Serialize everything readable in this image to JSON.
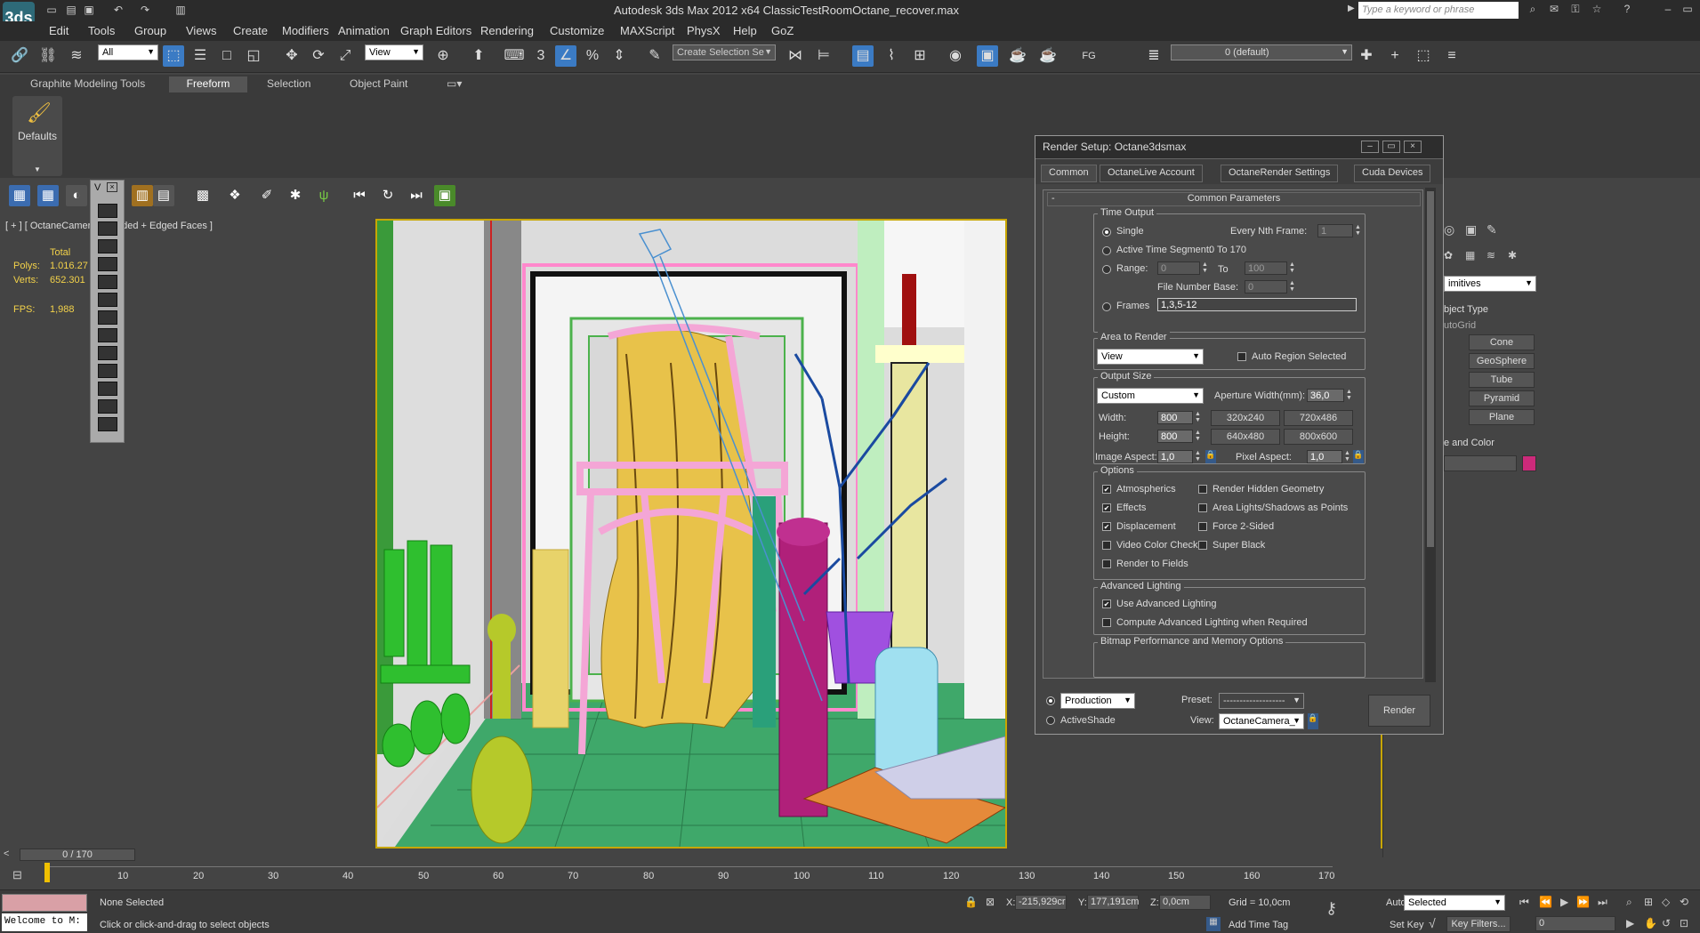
{
  "window": {
    "title": "Autodesk 3ds Max  2012 x64      ClassicTestRoomOctane_recover.max",
    "search_placeholder": "Type a keyword or phrase",
    "logo": "3ds"
  },
  "menu": [
    "Edit",
    "Tools",
    "Group",
    "Views",
    "Create",
    "Modifiers",
    "Animation",
    "Graph Editors",
    "Rendering",
    "Customize",
    "MAXScript",
    "PhysX",
    "Help",
    "GoZ"
  ],
  "toolbar": {
    "selection_filter": "All",
    "ref_coord": "View",
    "named_selection_placeholder": "Create Selection Se",
    "fg_label": "FG",
    "layer": "0 (default)"
  },
  "ribbon": {
    "tabs": [
      "Graphite Modeling Tools",
      "Freeform",
      "Selection",
      "Object Paint"
    ],
    "active_tab": "Freeform",
    "defaults_label": "Defaults"
  },
  "viewport": {
    "label": "[ + ] [ OctaneCamera [ Shaded + Edged Faces ]",
    "float_title": "V",
    "stats": {
      "total_label": "Total",
      "polys_label": "Polys:",
      "polys": "1.016.27",
      "verts_label": "Verts:",
      "verts": "652.301",
      "fps_label": "FPS:",
      "fps": "1,988"
    }
  },
  "command_panel": {
    "dropdown": "imitives",
    "object_type_header": "bject Type",
    "autogrid": "utoGrid",
    "buttons": [
      "Cone",
      "GeoSphere",
      "Tube",
      "Pyramid",
      "Plane"
    ],
    "name_color_header": "e and Color",
    "color_swatch": "#cc2a7a"
  },
  "render_setup": {
    "title": "Render Setup: Octane3dsmax",
    "tabs": [
      "Common",
      "OctaneLive Account",
      "OctaneRender Settings",
      "Cuda Devices"
    ],
    "active_tab": "Common",
    "rollout": "Common Parameters",
    "rollout_toggle": "-",
    "time_output": {
      "title": "Time Output",
      "single": "Single",
      "every_nth": "Every Nth Frame:",
      "every_nth_value": "1",
      "active_segment": "Active Time Segment:",
      "active_segment_value": "0 To 170",
      "range": "Range:",
      "range_from": "0",
      "range_to_label": "To",
      "range_to": "100",
      "file_number_base": "File Number Base:",
      "file_number_base_value": "0",
      "frames": "Frames",
      "frames_value": "1,3,5-12"
    },
    "area": {
      "title": "Area to Render",
      "value": "View",
      "auto_region": "Auto Region Selected"
    },
    "output_size": {
      "title": "Output Size",
      "preset": "Custom",
      "aperture_label": "Aperture Width(mm):",
      "aperture": "36,0",
      "width_label": "Width:",
      "width": "800",
      "height_label": "Height:",
      "height": "800",
      "presets": [
        "320x240",
        "720x486",
        "640x480",
        "800x600"
      ],
      "image_aspect_label": "Image Aspect:",
      "image_aspect": "1,0",
      "pixel_aspect_label": "Pixel Aspect:",
      "pixel_aspect": "1,0"
    },
    "options": {
      "title": "Options",
      "left": [
        {
          "label": "Atmospherics",
          "checked": true
        },
        {
          "label": "Effects",
          "checked": true
        },
        {
          "label": "Displacement",
          "checked": true
        },
        {
          "label": "Video Color Check",
          "checked": false
        },
        {
          "label": "Render to Fields",
          "checked": false
        }
      ],
      "right": [
        {
          "label": "Render Hidden Geometry",
          "checked": false
        },
        {
          "label": "Area Lights/Shadows as Points",
          "checked": false
        },
        {
          "label": "Force 2-Sided",
          "checked": false
        },
        {
          "label": "Super Black",
          "checked": false
        }
      ]
    },
    "advanced_lighting": {
      "title": "Advanced Lighting",
      "use": "Use Advanced Lighting",
      "compute": "Compute Advanced Lighting when Required"
    },
    "bitmap_title": "Bitmap Performance and Memory Options",
    "bottom": {
      "mode": "Production",
      "activeshade": "ActiveShade",
      "preset_label": "Preset:",
      "preset": "-------------------",
      "view_label": "View:",
      "view": "OctaneCamera_",
      "render_button": "Render"
    }
  },
  "timeline": {
    "slider": "0 / 170",
    "ticks": [
      "0",
      "10",
      "20",
      "30",
      "40",
      "50",
      "60",
      "70",
      "80",
      "90",
      "100",
      "110",
      "120",
      "130",
      "140",
      "150",
      "160",
      "170"
    ]
  },
  "status": {
    "welcome": "Welcome to M:",
    "selection": "None Selected",
    "prompt": "Click or click-and-drag to select objects",
    "x_label": "X:",
    "x": "-215,929cr",
    "y_label": "Y:",
    "y": "177,191cm",
    "z_label": "Z:",
    "z": "0,0cm",
    "grid": "Grid = 10,0cm",
    "add_time_tag": "Add Time Tag",
    "auto_key": "Auto Key",
    "key_mode": "Selected",
    "set_key": "Set Key",
    "key_filters": "Key Filters...",
    "frame": "0"
  }
}
